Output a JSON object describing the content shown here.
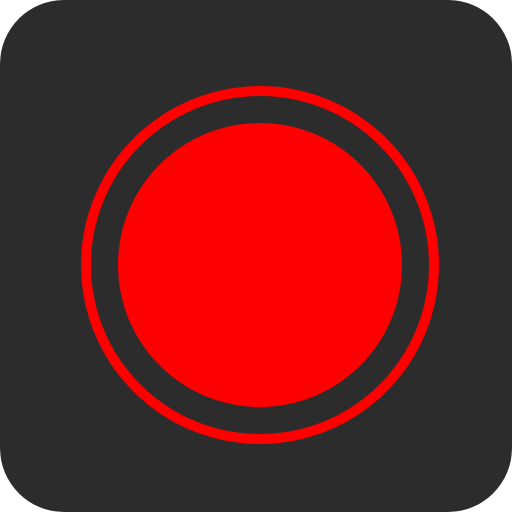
{
  "icon": {
    "name": "record-button-icon",
    "colors": {
      "background": "#2c2c2c",
      "accent": "#ff0000"
    }
  }
}
